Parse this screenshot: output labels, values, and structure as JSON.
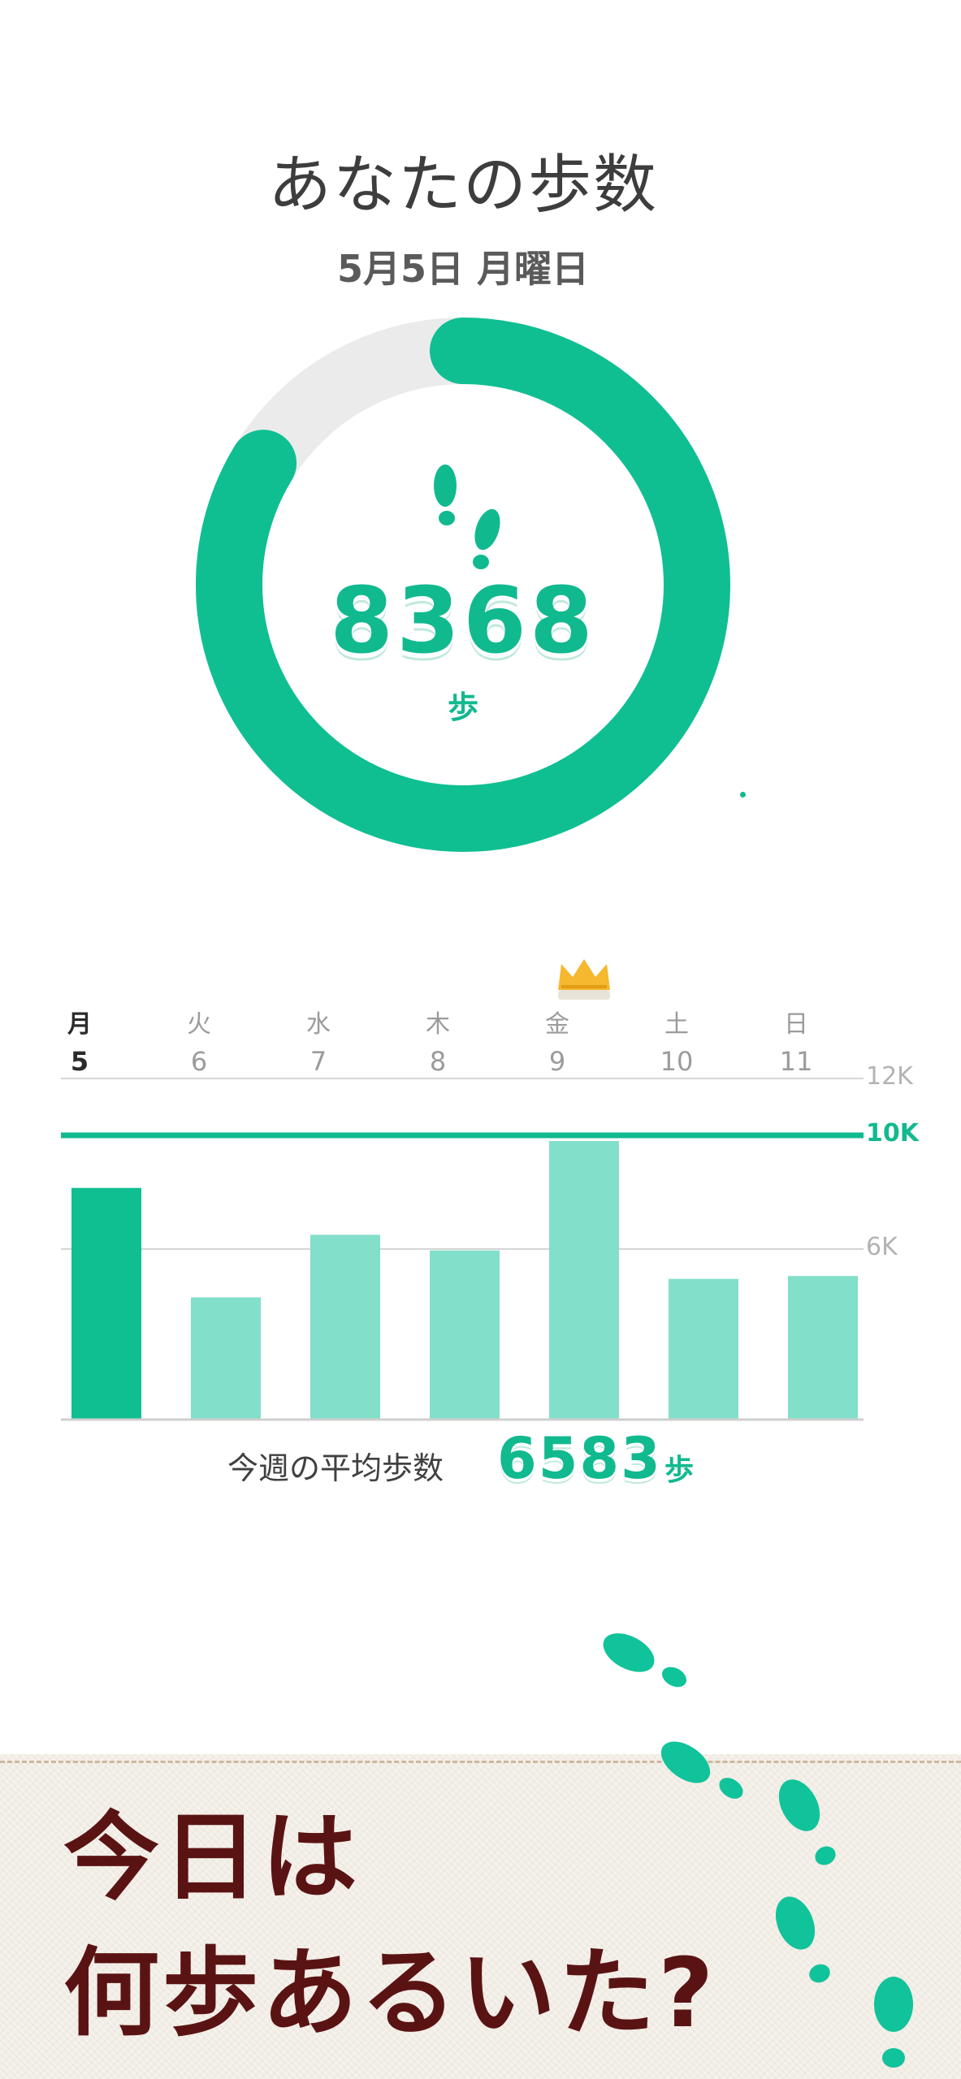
{
  "header": {
    "title": "あなたの歩数",
    "date": "5月5日 月曜日"
  },
  "today": {
    "steps": "8368",
    "unit": "歩",
    "goal_progress": 0.837
  },
  "week": {
    "days": [
      {
        "name": "月",
        "num": "5",
        "active": true
      },
      {
        "name": "火",
        "num": "6",
        "active": false
      },
      {
        "name": "水",
        "num": "7",
        "active": false
      },
      {
        "name": "木",
        "num": "8",
        "active": false
      },
      {
        "name": "金",
        "num": "9",
        "active": false,
        "crown": true
      },
      {
        "name": "土",
        "num": "10",
        "active": false
      },
      {
        "name": "日",
        "num": "11",
        "active": false
      }
    ],
    "ticks": {
      "top": "12K",
      "goal": "10K",
      "mid": "6K"
    }
  },
  "chart_data": {
    "type": "bar",
    "categories": [
      "月 5",
      "火 6",
      "水 7",
      "木 8",
      "金 9",
      "土 10",
      "日 11"
    ],
    "values": [
      8150,
      4300,
      6500,
      5950,
      9800,
      4950,
      5050
    ],
    "goal": 10000,
    "ylim": [
      0,
      12000
    ],
    "yticks": [
      "6K",
      "10K",
      "12K"
    ],
    "grid": true,
    "colors": {
      "active": "#0fbf92",
      "other": "#82dfc9",
      "goal": "#11b98f"
    }
  },
  "average": {
    "label": "今週の平均歩数",
    "value": "6583",
    "unit": "歩"
  },
  "banner": {
    "line1": "今日は",
    "line2": "何歩あるいた?"
  },
  "colors": {
    "accent": "#11b98f",
    "ring_bg": "#ebebeb",
    "slogan": "#5a1313"
  }
}
